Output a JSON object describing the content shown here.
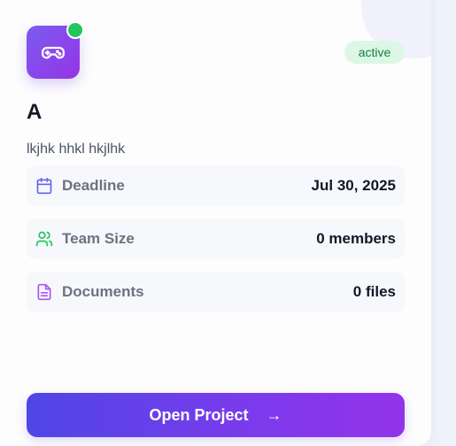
{
  "project": {
    "icon": "gamepad-icon",
    "status": "active",
    "title": "A",
    "description": "lkjhk hhkl hkjlhk"
  },
  "details": [
    {
      "icon": "calendar-icon",
      "label": "Deadline",
      "value": "Jul 30, 2025",
      "color": "#6366f1"
    },
    {
      "icon": "users-icon",
      "label": "Team Size",
      "value": "0 members",
      "color": "#22c55e"
    },
    {
      "icon": "document-icon",
      "label": "Documents",
      "value": "0 files",
      "color": "#a855f7"
    }
  ],
  "action": {
    "label": "Open Project",
    "arrow": "→"
  },
  "colors": {
    "accent_start": "#4f46e5",
    "accent_end": "#9333ea",
    "online": "#22c55e",
    "status_bg": "#dcf7e6",
    "status_text": "#15803d"
  }
}
